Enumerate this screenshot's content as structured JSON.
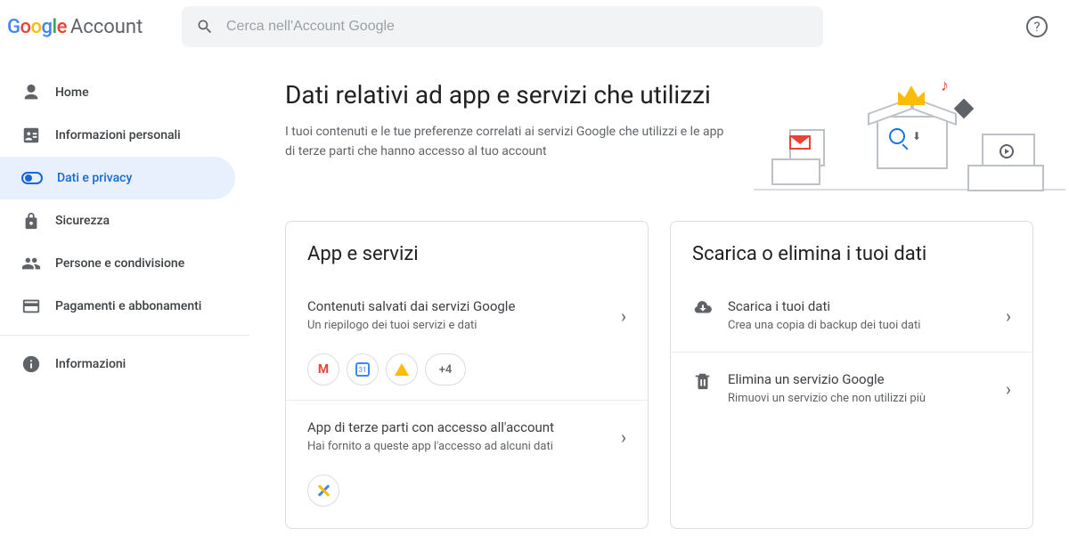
{
  "header": {
    "brand": "Google",
    "product": "Account",
    "search_placeholder": "Cerca nell'Account Google"
  },
  "sidebar": {
    "items": [
      {
        "label": "Home"
      },
      {
        "label": "Informazioni personali"
      },
      {
        "label": "Dati e privacy"
      },
      {
        "label": "Sicurezza"
      },
      {
        "label": "Persone e condivisione"
      },
      {
        "label": "Pagamenti e abbonamenti"
      },
      {
        "label": "Informazioni"
      }
    ]
  },
  "main": {
    "title": "Dati relativi ad app e servizi che utilizzi",
    "description": "I tuoi contenuti e le tue preferenze correlati ai servizi Google che utilizzi e le app di terze parti che hanno accesso al tuo account",
    "card_apps": {
      "title": "App e servizi",
      "item1": {
        "title": "Contenuti salvati dai servizi Google",
        "subtitle": "Un riepilogo dei tuoi servizi e dati",
        "more_badge": "+4"
      },
      "item2": {
        "title": "App di terze parti con accesso all'account",
        "subtitle": "Hai fornito a queste app l'accesso ad alcuni dati"
      }
    },
    "card_data": {
      "title": "Scarica o elimina i tuoi dati",
      "item1": {
        "title": "Scarica i tuoi dati",
        "subtitle": "Crea una copia di backup dei tuoi dati"
      },
      "item2": {
        "title": "Elimina un servizio Google",
        "subtitle": "Rimuovi un servizio che non utilizzi più"
      }
    }
  }
}
